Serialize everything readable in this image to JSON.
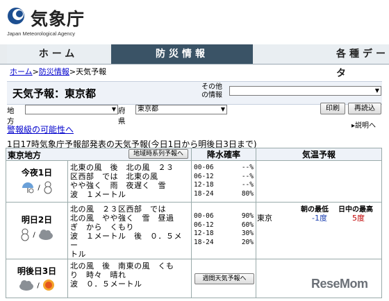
{
  "site": {
    "title": "気象庁",
    "subtitle": "Japan Meteorological Agency"
  },
  "nav": {
    "home": "ホーム",
    "bosai": "防災情報",
    "kakushu": "各種データ"
  },
  "breadcrumb": {
    "home": "ホーム",
    "bosai": "防災情報",
    "sep": ">",
    "current": "天気予報"
  },
  "page": {
    "title": "天気予報：東京都",
    "other_label_1": "その他",
    "other_label_2": "の情報"
  },
  "region": {
    "chiho_label": "地方",
    "fuken_label": "府県",
    "fuken_value": "東京都"
  },
  "buttons": {
    "print": "印刷",
    "reload": "再読込",
    "timeseries": "地域時系列予報へ",
    "weekly": "週間天気予報へ"
  },
  "links": {
    "warning": "警報級の可能性へ",
    "help": "説明へ"
  },
  "announcement": "1日17時気象庁予報部発表の天気予報(今日1日から明後日3日まで)",
  "table": {
    "area": "東京地方",
    "pop_header": "降水確率",
    "temp_header": "気温予報",
    "days": [
      {
        "label": "今夜1日",
        "icons": [
          "rain-snow",
          "snow"
        ],
        "weather": [
          "北東の風　後　北の風　２３",
          "区西部　では　北東の風",
          "やや強く　雨　夜遅く　雪",
          "波　１メートル"
        ],
        "pop": [
          [
            "00-06",
            "--%"
          ],
          [
            "06-12",
            "--%"
          ],
          [
            "12-18",
            "--%"
          ],
          [
            "18-24",
            "80%"
          ]
        ]
      },
      {
        "label": "明日2日",
        "icons": [
          "snow",
          "cloud"
        ],
        "weather": [
          "北の風　２３区西部　では",
          "北の風　やや強く　雪　昼過",
          "ぎ　から　くもり",
          "波　１メートル　後　０．５メー",
          "トル"
        ],
        "pop": [
          [
            "00-06",
            "90%"
          ],
          [
            "06-12",
            "60%"
          ],
          [
            "12-18",
            "30%"
          ],
          [
            "18-24",
            "20%"
          ]
        ],
        "temp": {
          "area": "東京",
          "min_label": "朝の最低",
          "max_label": "日中の最高",
          "min": "-1度",
          "max": "5度"
        }
      },
      {
        "label": "明後日3日",
        "icons": [
          "cloud",
          "sun"
        ],
        "weather": [
          "北の風　後　南東の風　くも",
          "り　時々　晴れ",
          "波　０．５メートル"
        ]
      }
    ]
  },
  "watermark": "ReseMom"
}
